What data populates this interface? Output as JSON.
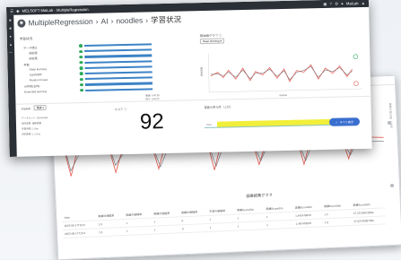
{
  "window": {
    "title": "MELSOFT MaiLab - MultipleRegression",
    "user": "MaiLab",
    "breadcrumb": [
      "MultipleRegression",
      "AI",
      "noodles",
      "学習状況"
    ]
  },
  "train_panel": {
    "title": "学習状況",
    "items": [
      {
        "label": "データ読込"
      },
      {
        "label": "前処理"
      },
      {
        "label": "前処理"
      },
      {
        "label": "学習"
      },
      {
        "label": "Deep learning"
      },
      {
        "label": "LightGBM"
      },
      {
        "label": "Random forest"
      },
      {
        "label": "AI作成(全体)"
      },
      {
        "label": "Extended learning"
      }
    ],
    "times": [
      "経過: 0:00:38",
      "残り: 0:00:00"
    ]
  },
  "graph_panel": {
    "title": "推論値グラフ",
    "model_select": "Deep learning",
    "y_label": "目的変数",
    "x_label": "Sample"
  },
  "bottom": {
    "target_label": "学習結果",
    "target_value": "推論",
    "dataset_label": "データセット: CarssDaat",
    "rows": [
      "目的変数: 価格変動",
      "学習時間: 1 Day",
      "目的変数 1: 1 Day"
    ],
    "score_title": "スコア",
    "score_value": "92",
    "importance_title": "重要の寄与度（上位）",
    "importance_label": "Pred",
    "importance_button": "すべて表示"
  },
  "back_window": {
    "graph_title": "誤差結果グラフ",
    "side_text": "重要の寄与度（上位）",
    "table_headers": [
      "Time",
      "実績の値幅率",
      "実績の値幅率",
      "実績の値幅率",
      "実績の値幅率",
      "予測の値幅率",
      "実績ScoreSim",
      "実績ScoreSim",
      "実績ScoreSim",
      "実績ScoreSim",
      "実績ScoreSim"
    ],
    "table_rows": [
      [
        "2022-06-17T10:0",
        "1.0",
        "1",
        "1",
        "0",
        "1",
        "1",
        "1",
        "1.442478973",
        "1.2",
        "47.2210501536a"
      ],
      [
        "2022-06-17T11:0",
        "1.0",
        "1",
        "1",
        "0",
        "1",
        "1",
        "1",
        "1.442478976",
        "1.0",
        "47.0214035746a"
      ]
    ]
  },
  "colors": {
    "titlebar": "#2b2f36",
    "progress": "#3d83c6",
    "status_ok": "#2eaa5c",
    "line_series": "#e8645a",
    "highlight": "#f1ef3a",
    "button": "#3a6fd0"
  }
}
